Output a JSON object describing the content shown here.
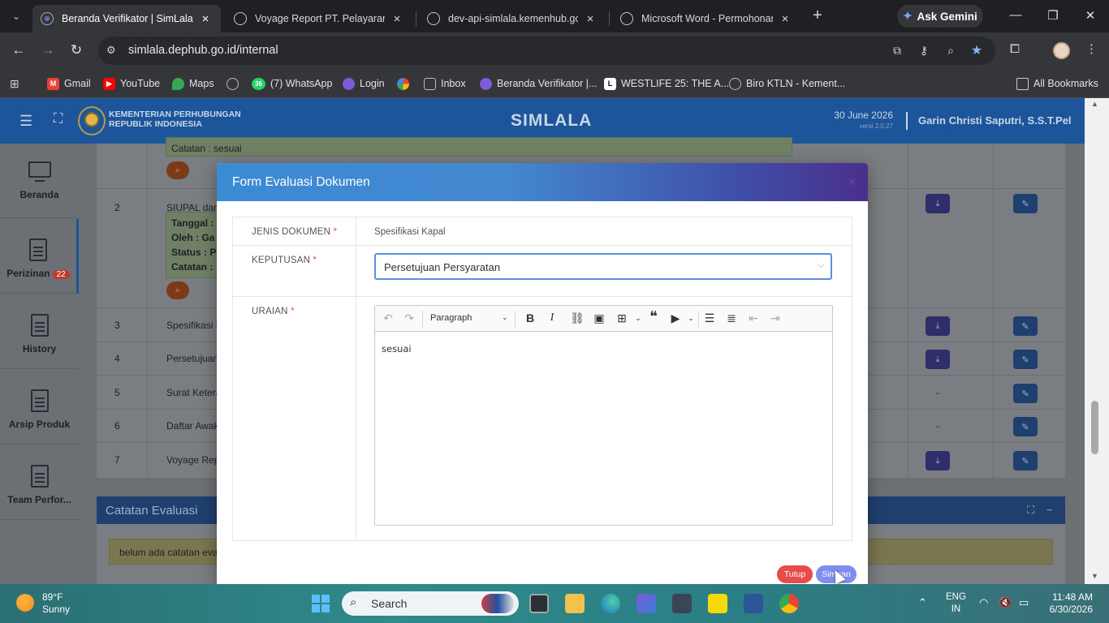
{
  "browser": {
    "tabs": [
      {
        "title": "Beranda Verifikator | SimLala",
        "active": true
      },
      {
        "title": "Voyage Report PT. Pelayaran Int",
        "active": false
      },
      {
        "title": "dev-api-simlala.kemenhub.go.id",
        "active": false
      },
      {
        "title": "Microsoft Word - Permohonan I",
        "active": false
      }
    ],
    "gemini_label": "Ask Gemini",
    "url": "simlala.dephub.go.id/internal",
    "bookmarks": [
      {
        "label": "Gmail",
        "icon": "gmail-icon",
        "color": "#ea4335"
      },
      {
        "label": "YouTube",
        "icon": "youtube-icon",
        "color": "#ff0000"
      },
      {
        "label": "Maps",
        "icon": "maps-icon",
        "color": "#34a853"
      },
      {
        "label": "",
        "icon": "globe-icon",
        "color": "#9aa0a6"
      },
      {
        "label": "(7) WhatsApp",
        "icon": "whatsapp-icon",
        "color": "#25d366",
        "badge": "36"
      },
      {
        "label": "Login",
        "icon": "login-icon",
        "color": "#7b5cd6"
      },
      {
        "label": "",
        "icon": "pinwheel-icon",
        "color": "#fbbc05"
      },
      {
        "label": "Inbox",
        "icon": "inbox-icon",
        "color": "#9aa0a6"
      },
      {
        "label": "Beranda Verifikator |...",
        "icon": "simlala-icon",
        "color": "#7b5cd6"
      },
      {
        "label": "WESTLIFE 25: THE A...",
        "icon": "westlife-icon",
        "color": "#ffffff"
      },
      {
        "label": "Biro KTLN - Kement...",
        "icon": "globe-icon",
        "color": "#9aa0a6"
      }
    ],
    "all_bookmarks_label": "All Bookmarks"
  },
  "app": {
    "org_line1": "KEMENTERIAN PERHUBUNGAN",
    "org_line2": "REPUBLIK INDONESIA",
    "title": "SIMLALA",
    "date": "30 June 2026",
    "version": "versi 2.0.27",
    "user": "Garin Christi Saputri, S.S.T.Pel"
  },
  "sidebar": {
    "items": [
      {
        "label": "Beranda",
        "icon": "monitor-icon"
      },
      {
        "label": "Perizinan",
        "icon": "document-icon",
        "badge": "22"
      },
      {
        "label": "History",
        "icon": "document-icon"
      },
      {
        "label": "Arsip Produk",
        "icon": "document-icon"
      },
      {
        "label": "Team Perfor...",
        "icon": "document-icon"
      }
    ]
  },
  "table": {
    "note_top": "Catatan : sesuai",
    "rows": [
      {
        "num": "2",
        "name": "SIUPAL dan E",
        "note_lines": [
          "Tanggal :",
          "Oleh : Ga",
          "Status : P",
          "Catatan :"
        ]
      },
      {
        "num": "3",
        "name": "Spesifikasi Ka",
        "col3": "download"
      },
      {
        "num": "4",
        "name": "Persetujuan S",
        "col3": "download"
      },
      {
        "num": "5",
        "name": "Surat Keterar",
        "col3": "-"
      },
      {
        "num": "6",
        "name": "Daftar Awak",
        "col3": "-"
      },
      {
        "num": "7",
        "name": "Voyage Repo",
        "col3": "download"
      }
    ]
  },
  "catatan": {
    "title": "Catatan Evaluasi",
    "body": "belum ada catatan evalu"
  },
  "modal": {
    "title": "Form Evaluasi Dokumen",
    "close": "×",
    "fields": {
      "jenis_label": "JENIS DOKUMEN",
      "jenis_value": "Spesifikasi Kapal",
      "keputusan_label": "KEPUTUSAN",
      "keputusan_value": "Persetujuan Persyaratan",
      "uraian_label": "URAIAN",
      "required_mark": "*"
    },
    "editor": {
      "format": "Paragraph",
      "content": "sesuai"
    },
    "buttons": {
      "tutup": "Tutup",
      "simpan": "Simpan"
    }
  },
  "taskbar": {
    "temp": "89°F",
    "condition": "Sunny",
    "search_placeholder": "Search",
    "lang1": "ENG",
    "lang2": "IN",
    "time": "11:48 AM",
    "date": "6/30/2026"
  }
}
